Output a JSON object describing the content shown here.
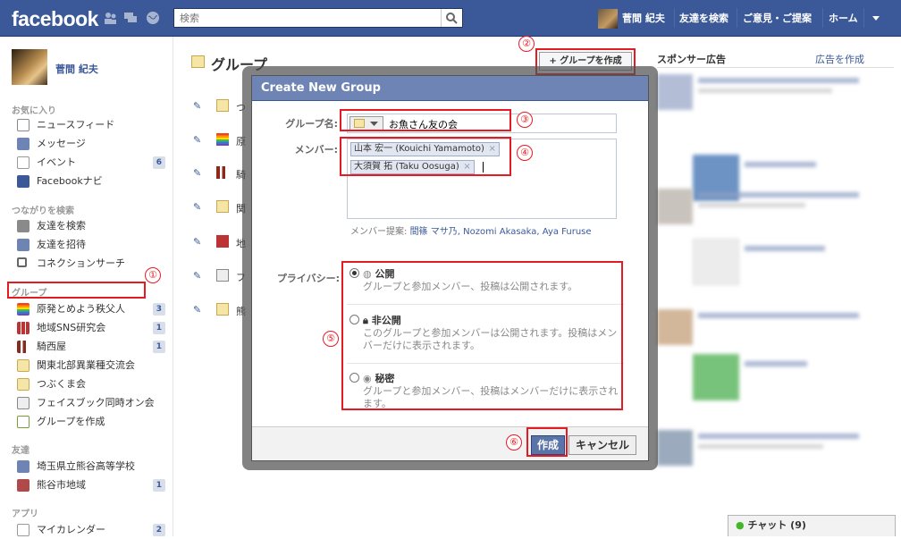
{
  "topbar": {
    "logo": "facebook",
    "search_placeholder": "検索",
    "user_name": "菅間 紀夫",
    "find_friends": "友達を検索",
    "feedback": "ご意見・ご提案",
    "home": "ホーム"
  },
  "left": {
    "profile_name": "菅間 紀夫",
    "favorites_head": "お気に入り",
    "favorites": [
      {
        "label": "ニュースフィード",
        "icon": "news-feed-icon",
        "count": ""
      },
      {
        "label": "メッセージ",
        "icon": "messages-icon",
        "count": ""
      },
      {
        "label": "イベント",
        "icon": "calendar-icon",
        "count": "6"
      },
      {
        "label": "Facebookナビ",
        "icon": "fbnavi-icon",
        "count": ""
      }
    ],
    "connect_head": "つながりを検索",
    "connect": [
      {
        "label": "友達を検索",
        "icon": "find-friends-icon"
      },
      {
        "label": "友達を招待",
        "icon": "invite-friends-icon"
      },
      {
        "label": "コネクションサーチ",
        "icon": "search-icon"
      }
    ],
    "groups_head": "グループ",
    "groups": [
      {
        "label": "原発とめよう秩父人",
        "icon": "rainbow-icon",
        "count": "3"
      },
      {
        "label": "地域SNS研究会",
        "icon": "building-icon",
        "count": "1"
      },
      {
        "label": "騎西屋",
        "icon": "bottles-icon",
        "count": "1"
      },
      {
        "label": "関東北部異業種交流会",
        "icon": "group-icon",
        "count": ""
      },
      {
        "label": "つぶくま会",
        "icon": "group-icon",
        "count": ""
      },
      {
        "label": "フェイスブック同時オン会",
        "icon": "mouse-icon",
        "count": ""
      },
      {
        "label": "グループを作成",
        "icon": "add-group-icon",
        "count": ""
      }
    ],
    "friends_head": "友達",
    "friends": [
      {
        "label": "埼玉県立熊谷高等学校",
        "icon": "school-icon",
        "count": ""
      },
      {
        "label": "熊谷市地域",
        "icon": "pin-icon",
        "count": "1"
      }
    ],
    "apps_head": "アプリ",
    "apps": [
      {
        "label": "マイカレンダー",
        "icon": "calendar-icon",
        "count": "2"
      }
    ]
  },
  "main": {
    "title": "グループ",
    "add_group": "+ グループを作成",
    "rows": [
      "つ",
      "原",
      "騎",
      "関",
      "地",
      "フ",
      "熊"
    ]
  },
  "right": {
    "sponsor": "スポンサー広告",
    "create_ad": "広告を作成",
    "chat": "チャット (9)"
  },
  "dialog": {
    "title": "Create New Group",
    "group_name_label": "グループ名:",
    "group_name_value": "お魚さん友の会",
    "members_label": "メンバー:",
    "members": [
      "山本 宏一 (Kouichi Yamamoto)",
      "大須賀 拓 (Taku Oosuga)"
    ],
    "remove_glyph": "×",
    "suggest_label": "メンバー提案:",
    "suggest_links": "間篠 マサ乃, Nozomi Akasaka, Aya Furuse",
    "privacy_label": "プライバシー:",
    "privacy": [
      {
        "title": "公開",
        "desc": "グループと参加メンバー、投稿は公開されます。"
      },
      {
        "title": "非公開",
        "desc": "このグループと参加メンバーは公開されます。投稿はメンバーだけに表示されます。"
      },
      {
        "title": "秘密",
        "desc": "グループと参加メンバー、投稿はメンバーだけに表示されます。"
      }
    ],
    "create": "作成",
    "cancel": "キャンセル"
  },
  "callouts": [
    "①",
    "②",
    "③",
    "④",
    "⑤",
    "⑥"
  ],
  "colors": {
    "brand": "#3b5998",
    "annotation": "#e51b24",
    "dialog_header": "#6d84b4"
  }
}
